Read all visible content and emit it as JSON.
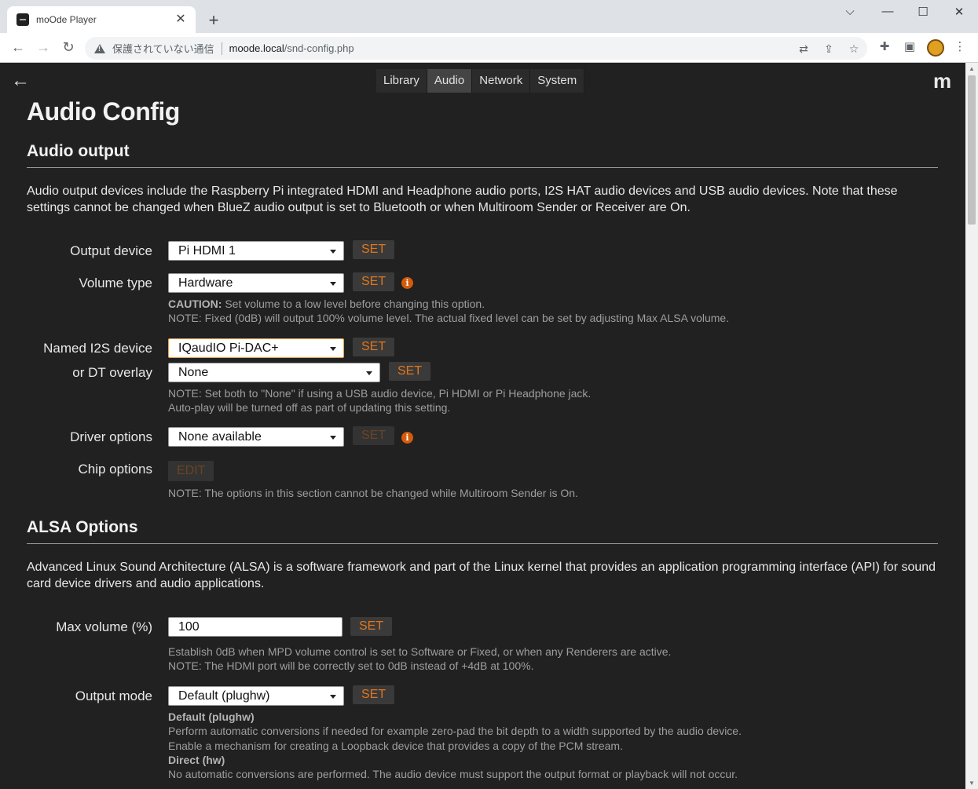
{
  "browser": {
    "tab_title": "moOde Player",
    "tab_close": "✕",
    "new_tab": "+",
    "window_controls": {
      "minimize": "⌵",
      "restore": "—",
      "maximize": "☐",
      "close": "✕"
    },
    "omnibox": {
      "security_text": "保護されていない通信",
      "url_host": "moode.local",
      "url_path": "/snd-config.php"
    }
  },
  "nav": {
    "back": "←",
    "brand": "m",
    "links": [
      "Library",
      "Audio",
      "Network",
      "System"
    ],
    "active": "Audio"
  },
  "page_title": "Audio Config",
  "audio_output": {
    "heading": "Audio output",
    "intro": "Audio output devices include the Raspberry Pi integrated HDMI and Headphone audio ports, I2S HAT audio devices and USB audio devices. Note that these settings cannot be changed when BlueZ audio output is set to Bluetooth or when Multiroom Sender or Receiver are On.",
    "output_device": {
      "label": "Output device",
      "value": "Pi HDMI 1",
      "button": "SET"
    },
    "volume_type": {
      "label": "Volume type",
      "value": "Hardware",
      "button": "SET",
      "caution_head": "CAUTION:",
      "caution": " Set volume to a low level before changing this option.",
      "note": "NOTE: Fixed (0dB) will output 100% volume level. The actual fixed level can be set by adjusting Max ALSA volume."
    },
    "named_i2s": {
      "label": "Named I2S device",
      "value": "IQaudIO Pi-DAC+",
      "button": "SET"
    },
    "dt_overlay": {
      "label": "or DT overlay",
      "value": "None",
      "button": "SET",
      "note1": "NOTE: Set both to \"None\" if using a USB audio device, Pi HDMI or Pi Headphone jack.",
      "note2": "Auto-play will be turned off as part of updating this setting."
    },
    "driver_options": {
      "label": "Driver options",
      "value": "None available",
      "button": "SET"
    },
    "chip_options": {
      "label": "Chip options",
      "button": "EDIT",
      "note": "NOTE: The options in this section cannot be changed while Multiroom Sender is On."
    }
  },
  "alsa": {
    "heading": "ALSA Options",
    "intro": "Advanced Linux Sound Architecture (ALSA) is a software framework and part of the Linux kernel that provides an application programming interface (API) for sound card device drivers and audio applications.",
    "max_volume": {
      "label": "Max volume (%)",
      "value": "100",
      "button": "SET",
      "note1": "Establish 0dB when MPD volume control is set to Software or Fixed, or when any Renderers are active.",
      "note2": "NOTE: The HDMI port will be correctly set to 0dB instead of +4dB at 100%."
    },
    "output_mode": {
      "label": "Output mode",
      "value": "Default (plughw)",
      "button": "SET",
      "default_head": "Default (plughw)",
      "default_line1": "Perform automatic conversions if needed for example zero-pad the bit depth to a width supported by the audio device.",
      "default_line2": "Enable a mechanism for creating a Loopback device that provides a copy of the PCM stream.",
      "direct_head": "Direct (hw)",
      "direct_line1": "No automatic conversions are performed. The audio device must support the output format or playback will not occur."
    }
  },
  "info_icon": "i"
}
